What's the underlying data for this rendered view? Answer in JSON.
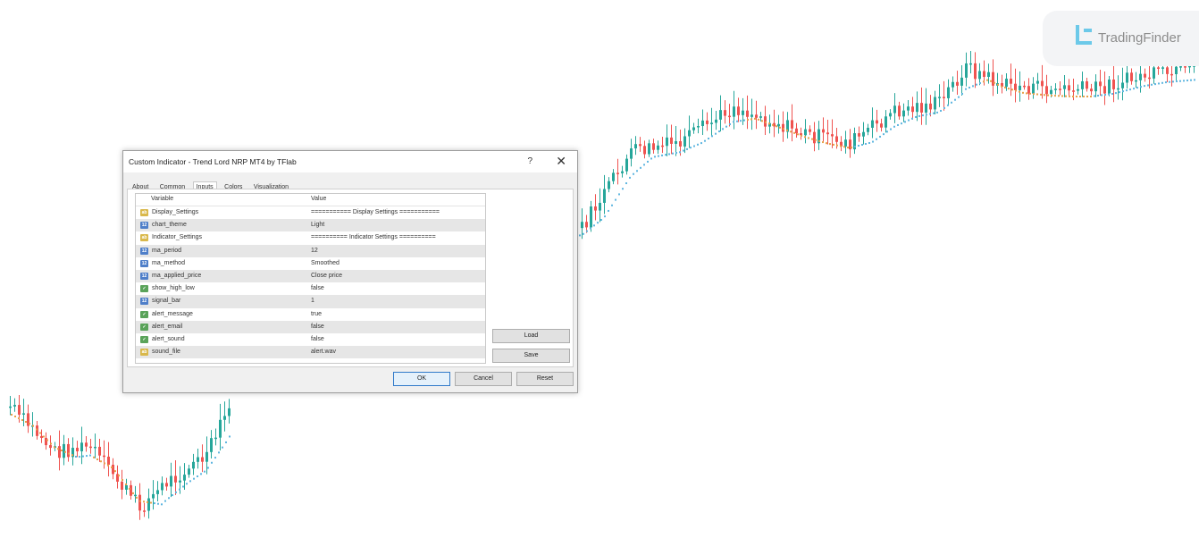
{
  "brand": {
    "name": "TradingFinder",
    "accent": "#6cc9e9"
  },
  "chart_colors": {
    "bull": "#26a69a",
    "bear": "#ef5350",
    "ma_up": "#5fb6e0",
    "ma_down": "#e8a04a"
  },
  "dialog": {
    "title": "Custom Indicator - Trend Lord NRP MT4 by TFlab",
    "help": "?",
    "close": "✕",
    "tabs": [
      "About",
      "Common",
      "Inputs",
      "Colors",
      "Visualization"
    ],
    "active_tab": "Inputs",
    "columns": {
      "variable": "Variable",
      "value": "Value"
    },
    "rows": [
      {
        "type": "str",
        "name": "Display_Settings",
        "value": "=========== Display Settings ==========="
      },
      {
        "type": "num",
        "name": "chart_theme",
        "value": "Light"
      },
      {
        "type": "str",
        "name": "Indicator_Settings",
        "value": "========== Indicator Settings =========="
      },
      {
        "type": "num",
        "name": "ma_period",
        "value": "12"
      },
      {
        "type": "num",
        "name": "ma_method",
        "value": "Smoothed"
      },
      {
        "type": "num",
        "name": "ma_applied_price",
        "value": "Close price"
      },
      {
        "type": "bool",
        "name": "show_high_low",
        "value": "false"
      },
      {
        "type": "num",
        "name": "signal_bar",
        "value": "1"
      },
      {
        "type": "bool",
        "name": "alert_message",
        "value": "true"
      },
      {
        "type": "bool",
        "name": "alert_email",
        "value": "false"
      },
      {
        "type": "bool",
        "name": "alert_sound",
        "value": "false"
      },
      {
        "type": "str",
        "name": "sound_file",
        "value": "alert.wav"
      }
    ],
    "buttons": {
      "load": "Load",
      "save": "Save",
      "ok": "OK",
      "cancel": "Cancel",
      "reset": "Reset"
    }
  }
}
